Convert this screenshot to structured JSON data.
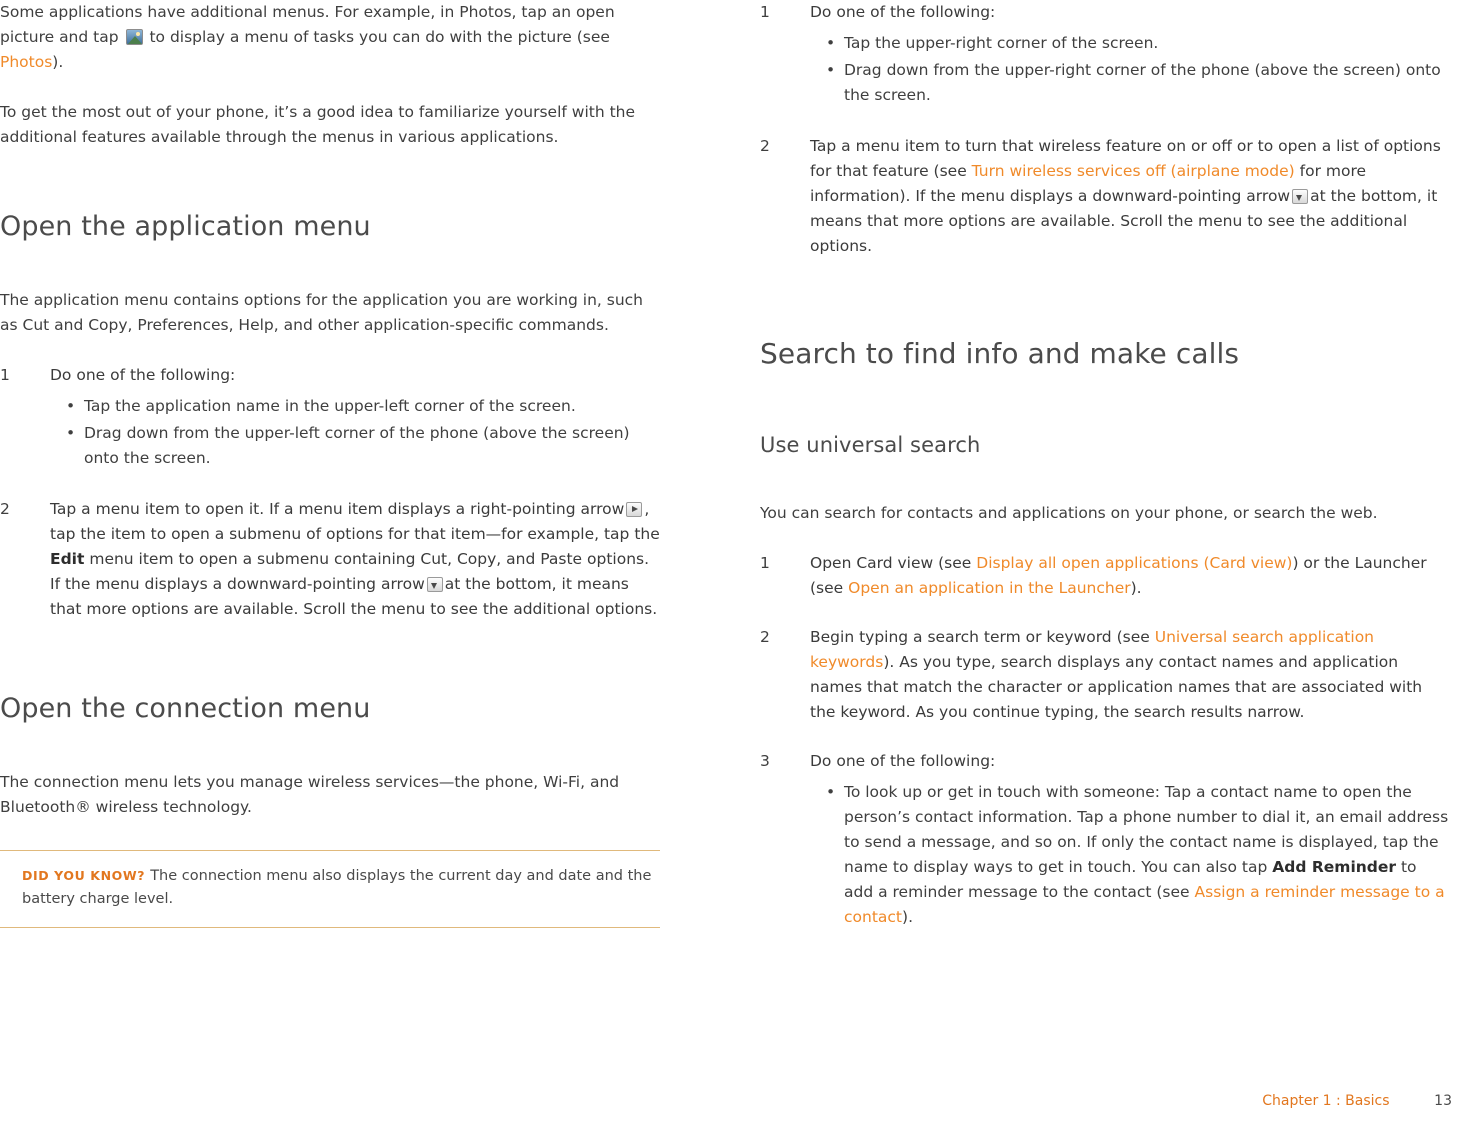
{
  "left": {
    "intro_p1_a": "Some applications have additional menus. For example, in Photos, tap an open picture and tap",
    "intro_p1_b": "to display a menu of tasks you can do with the picture (see",
    "intro_p1_link": "Photos",
    "intro_p1_c": ").",
    "intro_p2": "To get the most out of your phone, it’s a good idea to familiarize yourself with the additional features available through the menus in various applications.",
    "h1_app_menu": "Open the application menu",
    "app_menu_p": "The application menu contains options for the application you are working in, such as Cut and Copy, Preferences, Help, and other application-specific commands.",
    "step1_num": "1",
    "step1_text": "Do one of the following:",
    "step1_bullets": [
      "Tap the application name in the upper-left corner of the screen.",
      "Drag down from the upper-left corner of the phone (above the screen) onto the screen."
    ],
    "step2_num": "2",
    "step2_a": "Tap a menu item to open it. If a menu item displays a right-pointing arrow",
    "step2_b": ", tap the item to open a submenu of options for that item—for example, tap the",
    "step2_bold": "Edit",
    "step2_c": "menu item to open a submenu containing Cut, Copy, and Paste options. If the menu displays a downward-pointing arrow",
    "step2_d": "at the bottom, it means that more options are available. Scroll the menu to see the additional options.",
    "h1_connection_menu": "Open the connection menu",
    "connection_p": "The connection menu lets you manage wireless services—the phone, Wi-Fi, and Bluetooth® wireless technology.",
    "dyk_label": "Did you know?",
    "dyk_text": "The connection menu also displays the current day and date and the battery charge level."
  },
  "right": {
    "step1_num": "1",
    "step1_text": "Do one of the following:",
    "step1_bullets": [
      "Tap the upper-right corner of the screen.",
      "Drag down from the upper-right corner of the phone (above the screen) onto the screen."
    ],
    "step2_num": "2",
    "step2_a": "Tap a menu item to turn that wireless feature on or off or to open a list of options for that feature (see",
    "step2_link": "Turn wireless services off (airplane mode)",
    "step2_b": "for more information). If the menu displays a downward-pointing arrow",
    "step2_c": "at the bottom, it means that more options are available. Scroll the menu to see the additional options.",
    "h1_search": "Search to find info and make calls",
    "h2_universal": "Use universal search",
    "universal_p": "You can search for contacts and applications on your phone, or search the web.",
    "s1_num": "1",
    "s1_a": "Open Card view (see",
    "s1_link1": "Display all open applications (Card view)",
    "s1_b": ") or the Launcher (see",
    "s1_link2": "Open an application in the Launcher",
    "s1_c": ").",
    "s2_num": "2",
    "s2_a": "Begin typing a search term or keyword (see",
    "s2_link": "Universal search application keywords",
    "s2_b": "). As you type, search displays any contact names and application names that match the character or application names that are associated with the keyword. As you continue typing, the search results narrow.",
    "s3_num": "3",
    "s3_text": "Do one of the following:",
    "s3_bullet_a": "To look up or get in touch with someone: Tap a contact name to open the person’s contact information. Tap a phone number to dial it, an email address to send a message, and so on. If only the contact name is displayed, tap the name to display ways to get in touch. You can also tap",
    "s3_bullet_bold": "Add Reminder",
    "s3_bullet_b": "to add a reminder message to the contact (see",
    "s3_bullet_link": "Assign a reminder message to a contact",
    "s3_bullet_c": ")."
  },
  "footer": {
    "chapter": "Chapter 1 : Basics",
    "page": "13"
  },
  "colors": {
    "link": "#f08a2a",
    "accent": "#e2771f",
    "text": "#3f3f3f"
  }
}
